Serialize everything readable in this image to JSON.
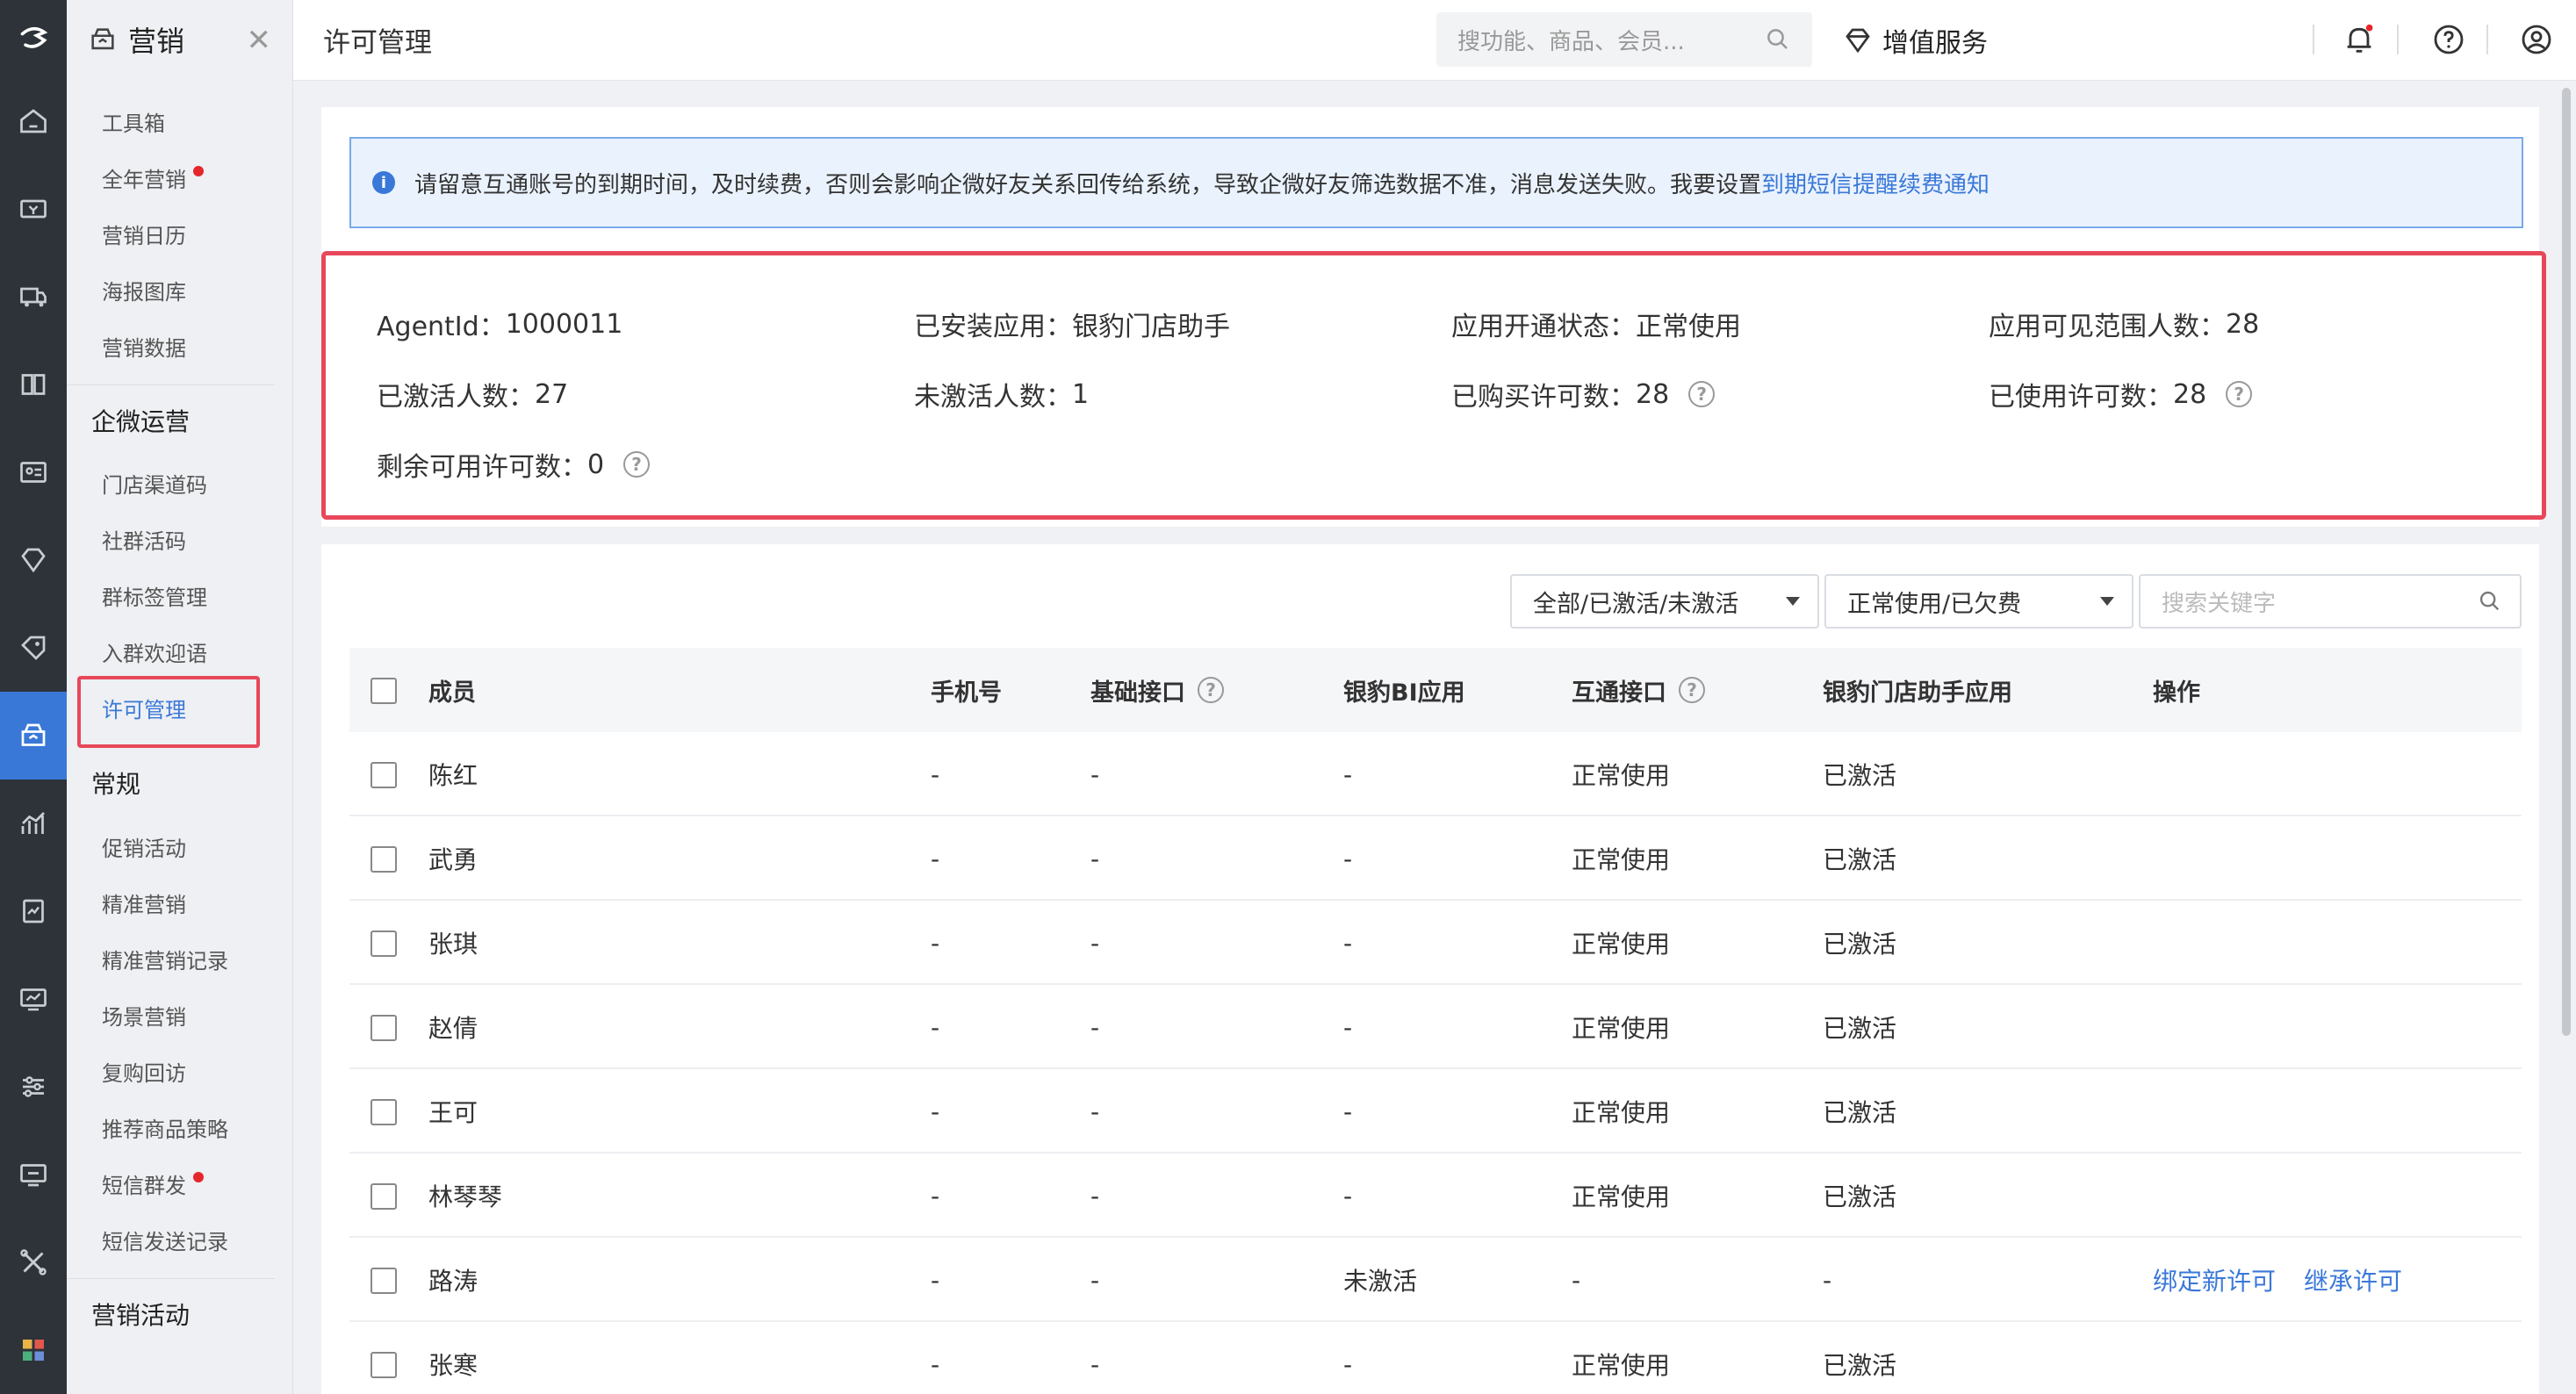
{
  "menu": {
    "section_title": "营销",
    "top_items": [
      {
        "label": "工具箱",
        "dot": false
      },
      {
        "label": "全年营销",
        "dot": true
      },
      {
        "label": "营销日历",
        "dot": false
      },
      {
        "label": "海报图库",
        "dot": false
      },
      {
        "label": "营销数据",
        "dot": false
      }
    ],
    "group1": "企微运营",
    "group1_items": [
      "门店渠道码",
      "社群活码",
      "群标签管理",
      "入群欢迎语",
      "许可管理"
    ],
    "group2": "常规",
    "group2_items": [
      {
        "label": "促销活动",
        "dot": false
      },
      {
        "label": "精准营销",
        "dot": false
      },
      {
        "label": "精准营销记录",
        "dot": false
      },
      {
        "label": "场景营销",
        "dot": false
      },
      {
        "label": "复购回访",
        "dot": false
      },
      {
        "label": "推荐商品策略",
        "dot": false
      },
      {
        "label": "短信群发",
        "dot": true
      },
      {
        "label": "短信发送记录",
        "dot": false
      }
    ],
    "group3": "营销活动"
  },
  "header": {
    "title": "许可管理",
    "search_placeholder": "搜功能、商品、会员...",
    "value_service": "增值服务"
  },
  "notice": {
    "text": "请留意互通账号的到期时间，及时续费，否则会影响企微好友关系回传给系统，导致企微好友筛选数据不准，消息发送失败。我要设置",
    "link": "到期短信提醒续费通知"
  },
  "stats": {
    "agent_label": "AgentId：",
    "agent_value": "1000011",
    "installed_label": "已安装应用：",
    "installed_value": "银豹门店助手",
    "status_label": "应用开通状态：",
    "status_value": "正常使用",
    "visible_label": "应用可见范围人数：",
    "visible_value": "28",
    "activated_label": "已激活人数：",
    "activated_value": "27",
    "inactive_label": "未激活人数：",
    "inactive_value": "1",
    "bought_label": "已购买许可数：",
    "bought_value": "28",
    "used_label": "已使用许可数：",
    "used_value": "28",
    "remain_label": "剩余可用许可数：",
    "remain_value": "0"
  },
  "filters": {
    "activation": "全部/已激活/未激活",
    "usage": "正常使用/已欠费",
    "keyword_placeholder": "搜索关键字"
  },
  "table": {
    "columns": [
      "成员",
      "手机号",
      "基础接口",
      "银豹BI应用",
      "互通接口",
      "银豹门店助手应用",
      "操作"
    ],
    "rows": [
      {
        "name": "陈红",
        "phone": "-",
        "base": "-",
        "bi": "-",
        "inter": "正常使用",
        "assistant": "已激活",
        "ops": []
      },
      {
        "name": "武勇",
        "phone": "-",
        "base": "-",
        "bi": "-",
        "inter": "正常使用",
        "assistant": "已激活",
        "ops": []
      },
      {
        "name": "张琪",
        "phone": "-",
        "base": "-",
        "bi": "-",
        "inter": "正常使用",
        "assistant": "已激活",
        "ops": []
      },
      {
        "name": "赵倩",
        "phone": "-",
        "base": "-",
        "bi": "-",
        "inter": "正常使用",
        "assistant": "已激活",
        "ops": []
      },
      {
        "name": "王可",
        "phone": "-",
        "base": "-",
        "bi": "-",
        "inter": "正常使用",
        "assistant": "已激活",
        "ops": []
      },
      {
        "name": "林琴琴",
        "phone": "-",
        "base": "-",
        "bi": "-",
        "inter": "正常使用",
        "assistant": "已激活",
        "ops": []
      },
      {
        "name": "路涛",
        "phone": "-",
        "base": "-",
        "bi": "未激活",
        "inter": "-",
        "assistant": "-",
        "ops": [
          "绑定新许可",
          "继承许可"
        ]
      },
      {
        "name": "张寒",
        "phone": "-",
        "base": "-",
        "bi": "-",
        "inter": "正常使用",
        "assistant": "已激活",
        "ops": []
      }
    ]
  },
  "colors": {
    "accent": "#3a78d8",
    "highlight": "#e8475a",
    "rail": "#2d3338"
  }
}
